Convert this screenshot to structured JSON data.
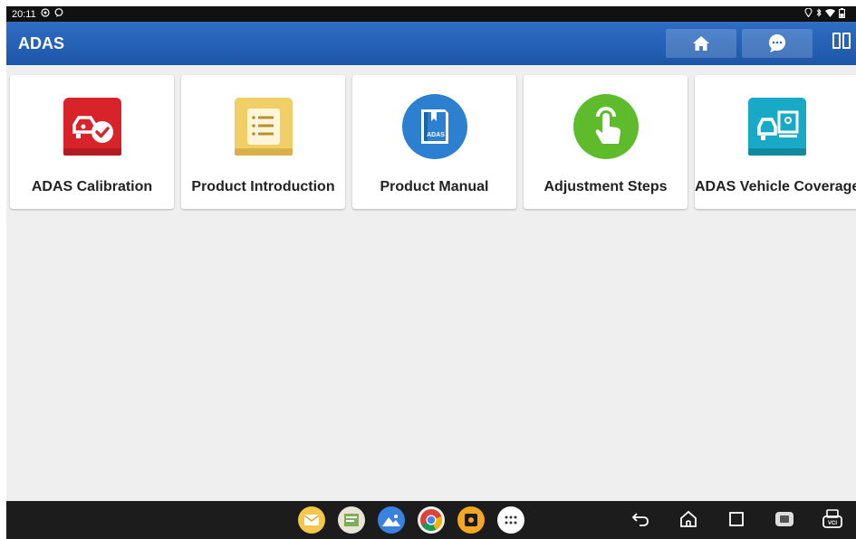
{
  "status_bar": {
    "time": "20:11",
    "left_icons": [
      "settings-status-icon",
      "message-status-icon"
    ],
    "right_icons": [
      "location-icon",
      "bluetooth-icon",
      "wifi-icon",
      "battery-icon"
    ]
  },
  "header": {
    "title": "ADAS",
    "buttons": [
      "home-icon",
      "chat-icon",
      "window-split-icon"
    ],
    "color": "#2f6ec4"
  },
  "tiles": [
    {
      "label": "ADAS Calibration",
      "icon": "adas-calibration-icon",
      "color": "#d8232a"
    },
    {
      "label": "Product Introduction",
      "icon": "document-list-icon",
      "color": "#f2cf66"
    },
    {
      "label": "Product Manual",
      "icon": "manual-book-icon",
      "color": "#2d7fd0"
    },
    {
      "label": "Adjustment Steps",
      "icon": "touch-hand-icon",
      "color": "#5dbb2c"
    },
    {
      "label": "ADAS Vehicle Coverage",
      "icon": "vehicle-coverage-icon",
      "color": "#17a9c6"
    }
  ],
  "dock": {
    "apps": [
      "email-app-icon",
      "notes-app-icon",
      "gallery-app-icon",
      "chrome-app-icon",
      "diagnostic-app-icon",
      "app-drawer-icon"
    ]
  },
  "nav_keys": [
    "back-icon",
    "home-nav-icon",
    "recents-icon",
    "screenshot-icon",
    "vci-icon"
  ]
}
